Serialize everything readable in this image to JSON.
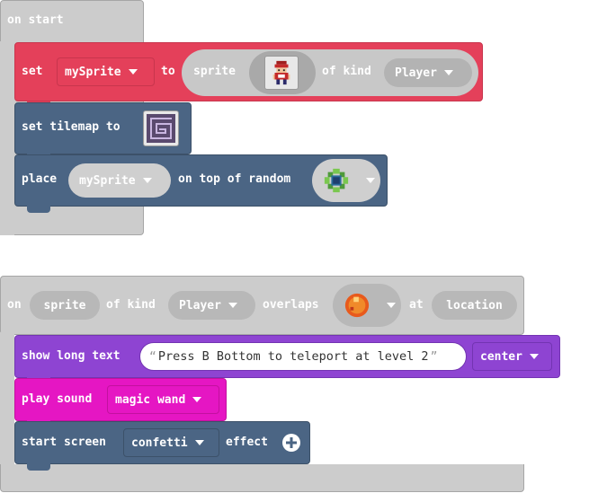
{
  "colors": {
    "event": "#cccccc",
    "sprites": "#e4405a",
    "scene": "#4b6584",
    "text": "#8e44d2",
    "music": "#e516c3",
    "white": "#ffffff"
  },
  "on_start": {
    "label": "on start",
    "set_block": {
      "set_label": "set",
      "variable": "mySprite",
      "to_label": "to",
      "sprite_label": "sprite",
      "sprite_image_icon": "player-avatar-icon",
      "of_kind_label": "of kind",
      "kind": "Player"
    },
    "tilemap_block": {
      "label": "set tilemap to",
      "tilemap_icon": "tilemap-maze-icon"
    },
    "place_block": {
      "place_label": "place",
      "variable": "mySprite",
      "on_top_label": "on top of random",
      "tile_icon": "flower-tile-icon"
    }
  },
  "overlap_event": {
    "on_label": "on",
    "sprite_label": "sprite",
    "of_kind_label": "of kind",
    "kind": "Player",
    "overlaps_label": "overlaps",
    "tile_icon": "orange-orb-tile-icon",
    "at_label": "at",
    "location_label": "location",
    "show_text_block": {
      "label": "show long text",
      "text_value": "Press B Bottom to teleport at level 2",
      "position": "center"
    },
    "sound_block": {
      "label": "play sound",
      "sound": "magic wand"
    },
    "effect_block": {
      "start_label": "start screen",
      "effect": "confetti",
      "effect_label": "effect",
      "add_icon": "plus-circle-icon"
    }
  }
}
